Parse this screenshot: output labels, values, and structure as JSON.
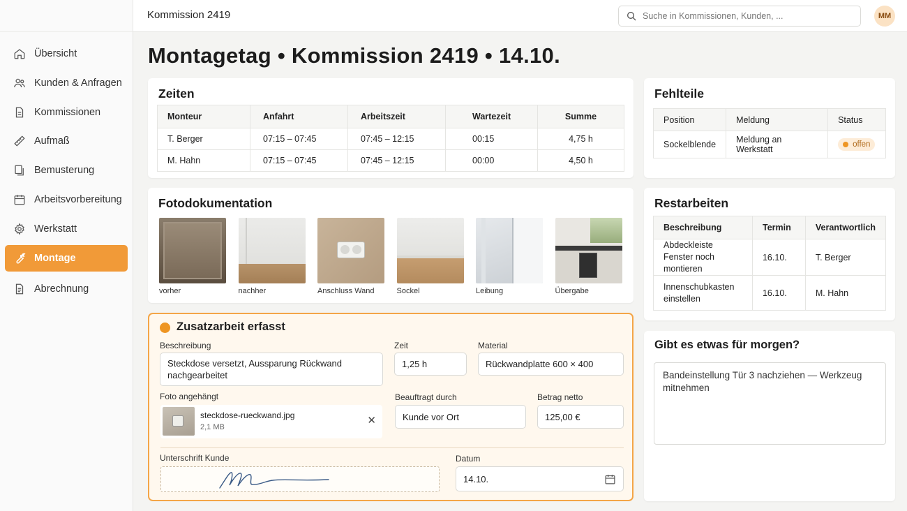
{
  "header": {
    "title": "Kommission 2419",
    "search_placeholder": "Suche in Kommissionen, Kunden, ...",
    "avatar_initials": "MM"
  },
  "sidebar": {
    "items": [
      {
        "label": "Übersicht",
        "icon": "home-icon"
      },
      {
        "label": "Kunden & Anfragen",
        "icon": "users-icon"
      },
      {
        "label": "Kommissionen",
        "icon": "document-icon"
      },
      {
        "label": "Aufmaß",
        "icon": "ruler-icon"
      },
      {
        "label": "Bemusterung",
        "icon": "copy-icon"
      },
      {
        "label": "Arbeitsvorbereitung",
        "icon": "calendar-icon"
      },
      {
        "label": "Werkstatt",
        "icon": "gear-icon"
      },
      {
        "label": "Montage",
        "icon": "wrench-icon",
        "active": true
      },
      {
        "label": "Abrechnung",
        "icon": "invoice-icon"
      }
    ]
  },
  "page_title": "Montagetag • Kommission 2419 • 14.10.",
  "zeiten": {
    "title": "Zeiten",
    "columns": [
      "Monteur",
      "Anfahrt",
      "Arbeitszeit",
      "Wartezeit",
      "Summe"
    ],
    "rows": [
      [
        "T. Berger",
        "07:15 – 07:45",
        "07:45 – 12:15",
        "00:15",
        "4,75 h"
      ],
      [
        "M. Hahn",
        "07:15 – 07:45",
        "07:45 – 12:15",
        "00:00",
        "4,50 h"
      ]
    ]
  },
  "fotos": {
    "title": "Fotodokumentation",
    "items": [
      {
        "caption": "vorher"
      },
      {
        "caption": "nachher"
      },
      {
        "caption": "Anschluss Wand"
      },
      {
        "caption": "Sockel"
      },
      {
        "caption": "Leibung"
      },
      {
        "caption": "Übergabe"
      }
    ]
  },
  "zusatzarbeit": {
    "title": "Zusatzarbeit erfasst",
    "beschreibung_label": "Beschreibung",
    "beschreibung_value": "Steckdose versetzt, Aussparung Rückwand nachgearbeitet",
    "zeit_label": "Zeit",
    "zeit_value": "1,25 h",
    "material_label": "Material",
    "material_value": "Rückwandplatte 600 × 400",
    "foto_label": "Foto angehängt",
    "attachment_name": "steckdose-rueckwand.jpg",
    "attachment_size": "2,1 MB",
    "beauftragt_label": "Beauftragt durch",
    "beauftragt_value": "Kunde vor Ort",
    "betrag_label": "Betrag netto",
    "betrag_value": "125,00 €",
    "unterschrift_label": "Unterschrift Kunde",
    "datum_label": "Datum",
    "datum_value": "14.10."
  },
  "fehlteile": {
    "title": "Fehlteile",
    "columns": [
      "Position",
      "Meldung",
      "Status"
    ],
    "rows": [
      {
        "position": "Sockelblende",
        "meldung": "Meldung an Werkstatt",
        "status": "offen"
      }
    ]
  },
  "restarbeiten": {
    "title": "Restarbeiten",
    "columns": [
      "Beschreibung",
      "Termin",
      "Verantwortlich"
    ],
    "rows": [
      [
        "Abdeckleiste Fenster noch montieren",
        "16.10.",
        "T. Berger"
      ],
      [
        "Innenschubkasten einstellen",
        "16.10.",
        "M. Hahn"
      ]
    ]
  },
  "morgen": {
    "title": "Gibt es etwas für morgen?",
    "value": "Bandeinstellung Tür 3 nachziehen — Werkzeug mitnehmen"
  },
  "colors": {
    "accent": "#f19a38",
    "status_open": "#ee9522"
  }
}
